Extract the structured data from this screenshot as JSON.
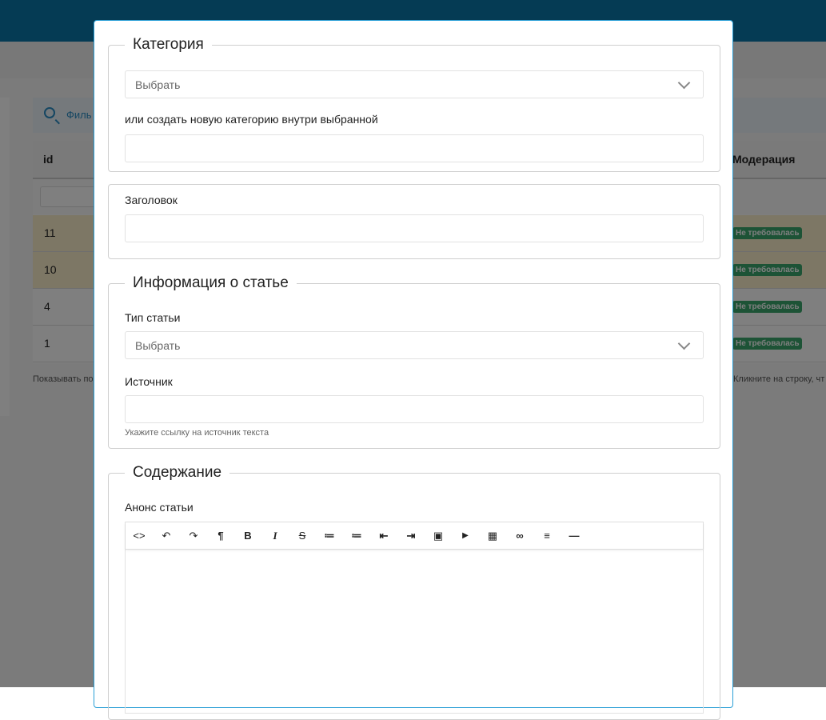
{
  "background": {
    "filter_label": "Филь",
    "table": {
      "col_id": "id",
      "col_moderation": "Модерация",
      "rows": [
        {
          "id": "11",
          "status": "Не требовалась"
        },
        {
          "id": "10",
          "status": "Не требовалась"
        },
        {
          "id": "4",
          "status": "Не требовалась"
        },
        {
          "id": "1",
          "status": "Не требовалась"
        }
      ]
    },
    "footer_left": "Показывать по",
    "footer_right": "Кликните на строку, чт"
  },
  "modal": {
    "category": {
      "legend": "Категория",
      "select_value": "Выбрать",
      "new_category_label": "или создать новую категорию внутри выбранной",
      "new_category_value": ""
    },
    "title": {
      "label": "Заголовок",
      "value": ""
    },
    "article_info": {
      "legend": "Информация о статье",
      "type_label": "Тип статьи",
      "type_value": "Выбрать",
      "source_label": "Источник",
      "source_value": "",
      "source_hint": "Укажите ссылку на источник текста"
    },
    "content": {
      "legend": "Содержание",
      "announce_label": "Анонс статьи",
      "toolbar": [
        {
          "name": "html-icon",
          "glyph": "<>"
        },
        {
          "name": "undo-icon",
          "glyph": "↶"
        },
        {
          "name": "redo-icon",
          "glyph": "↷"
        },
        {
          "name": "paragraph-icon",
          "glyph": "¶"
        },
        {
          "name": "bold-icon",
          "glyph": "B"
        },
        {
          "name": "italic-icon",
          "glyph": "I"
        },
        {
          "name": "strikethrough-icon",
          "glyph": "S"
        },
        {
          "name": "unordered-list-icon",
          "glyph": "≔"
        },
        {
          "name": "ordered-list-icon",
          "glyph": "≔"
        },
        {
          "name": "outdent-icon",
          "glyph": "⇤"
        },
        {
          "name": "indent-icon",
          "glyph": "⇥"
        },
        {
          "name": "image-icon",
          "glyph": "▣"
        },
        {
          "name": "video-icon",
          "glyph": "▶"
        },
        {
          "name": "table-icon",
          "glyph": "▦"
        },
        {
          "name": "link-icon",
          "glyph": "∞"
        },
        {
          "name": "align-icon",
          "glyph": "≡"
        },
        {
          "name": "horizontal-rule-icon",
          "glyph": "—"
        }
      ]
    }
  }
}
